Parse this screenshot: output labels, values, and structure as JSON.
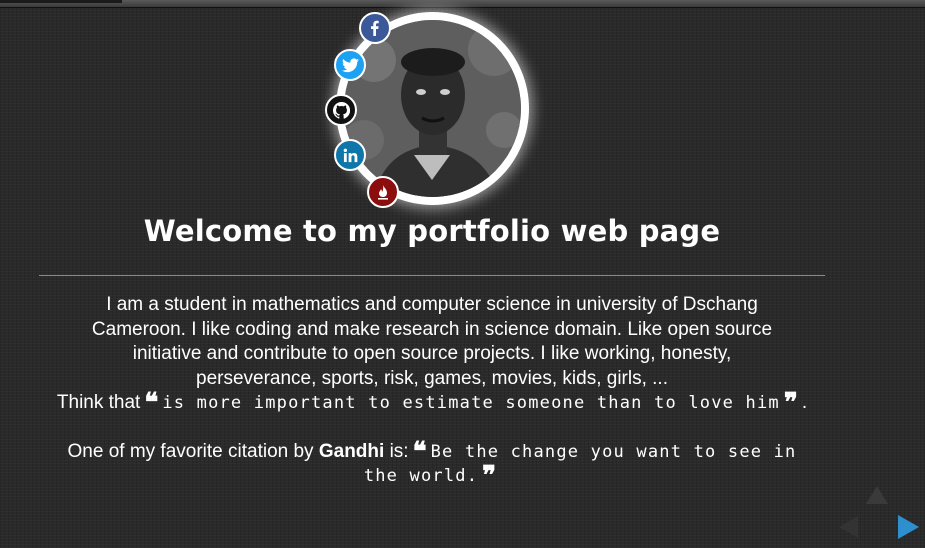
{
  "header": {
    "title": "Welcome to my portfolio web page"
  },
  "social": [
    {
      "name": "facebook",
      "icon": "facebook-icon",
      "color": "#3b5998"
    },
    {
      "name": "twitter",
      "icon": "twitter-icon",
      "color": "#1da1f2"
    },
    {
      "name": "github",
      "icon": "github-icon",
      "color": "#111111"
    },
    {
      "name": "linkedin",
      "icon": "linkedin-icon",
      "color": "#0e76a8"
    },
    {
      "name": "blog",
      "icon": "flame-icon",
      "color": "#8b0d0d"
    }
  ],
  "about": {
    "line1": "I am a student in mathematics and computer science in university of Dschang",
    "line2": "Cameroon. I like coding and make research in science domain. Like open source",
    "line3": "initiative and contribute to open source projects. I like working, honesty,",
    "line4": "perseverance, sports, risk, games, movies, kids, girls, ...",
    "think_prefix": "Think that",
    "think_quote": "is more important to estimate someone than to love him",
    "think_end": ".",
    "citation_prefix": "One of my favorite citation by",
    "citation_author": "Gandhi",
    "citation_mid": "is:",
    "citation_quote_1": "Be the change you want to see in",
    "citation_quote_2": "the world."
  },
  "quote_open": "❝",
  "quote_close": "❞",
  "navigation": {
    "up": "arrow-up-icon",
    "left": "arrow-left-icon",
    "right": "arrow-right-icon",
    "active_color": "#2e8fcf"
  }
}
